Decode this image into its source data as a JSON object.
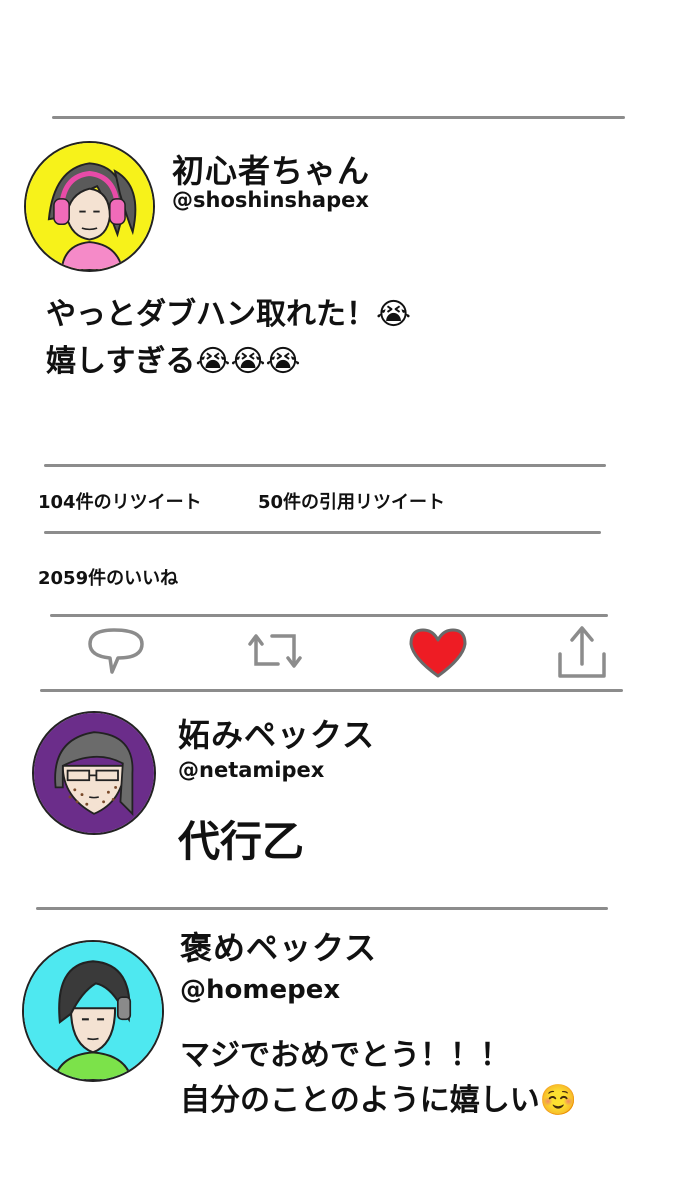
{
  "main_post": {
    "display_name": "初心者ちゃん",
    "handle": "@shoshinshapex",
    "avatar_bg": "#f7f21a",
    "text_line1": "やっとダブハン取れた！😭",
    "text_line2": "嬉しすぎる😭😭😭"
  },
  "stats": {
    "retweets": "104件のリツイート",
    "quote_tweets": "50件の引用リツイート",
    "likes": "2059件のいいね"
  },
  "actions": {
    "like_color": "#ee1c24"
  },
  "replies": [
    {
      "display_name": "妬みペックス",
      "handle": "@netamipex",
      "text_line1": "代行乙",
      "text_line2": "",
      "avatar_bg": "#6b2d8a"
    },
    {
      "display_name": "褒めペックス",
      "handle": "@homepex",
      "text_line1": "マジでおめでとう！！！",
      "text_line2": "自分のことのように嬉しい☺️",
      "avatar_bg": "#4ee8f0"
    }
  ]
}
